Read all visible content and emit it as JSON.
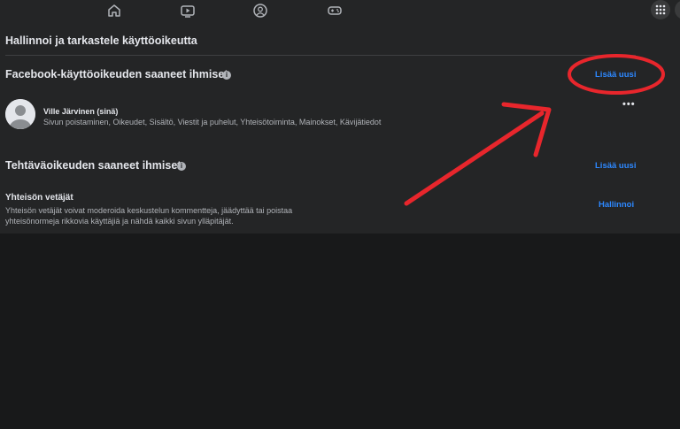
{
  "nav": {
    "icons": [
      "home-icon",
      "watch-icon",
      "groups-icon",
      "gaming-icon"
    ],
    "menu_icon": "grid-menu-icon"
  },
  "page": {
    "title": "Hallinnoi ja tarkastele käyttöoikeutta"
  },
  "facebook_access": {
    "title": "Facebook-käyttöoikeuden saaneet ihmiset",
    "add_label": "Lisää uusi",
    "people": [
      {
        "name": "Ville Järvinen (sinä)",
        "permissions": "Sivun poistaminen, Oikeudet, Sisältö, Viestit ja puhelut, Yhteisötoiminta, Mainokset, Kävijätiedot"
      }
    ]
  },
  "task_access": {
    "title": "Tehtäväoikeuden saaneet ihmiset",
    "add_label": "Lisää uusi",
    "role": {
      "title": "Yhteisön vetäjät",
      "description": "Yhteisön vetäjät voivat moderoida keskustelun kommentteja, jäädyttää tai poistaa yhteisönormeja rikkovia käyttäjiä ja nähdä kaikki sivun ylläpitäjät.",
      "manage_label": "Hallinnoi"
    }
  },
  "colors": {
    "background": "#18191a",
    "panel": "#242526",
    "link": "#2d88ff",
    "annotation": "#e8262c"
  }
}
